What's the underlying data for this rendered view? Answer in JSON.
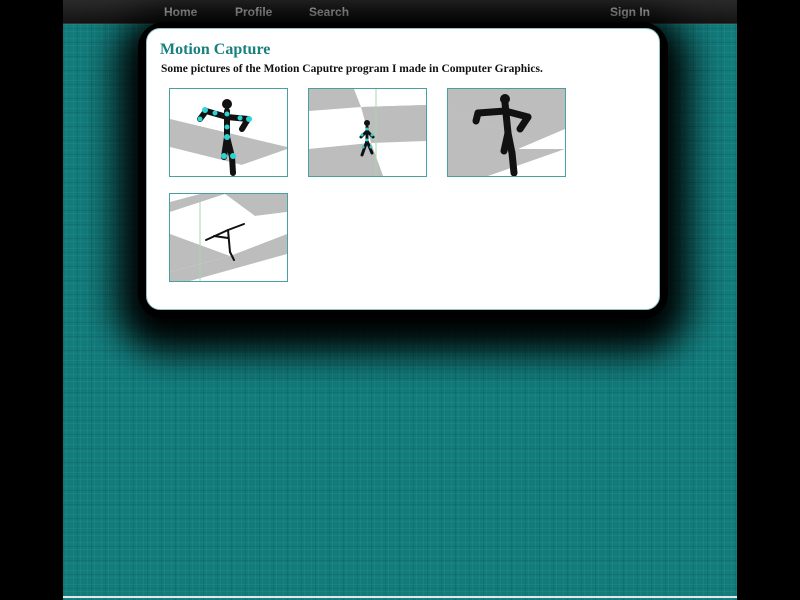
{
  "nav": {
    "home": "Home",
    "profile": "Profile",
    "search": "Search",
    "sign_in": "Sign In"
  },
  "content": {
    "title": "Motion Capture",
    "description": "Some pictures of the Motion Caputre program I made in Computer Graphics."
  },
  "gallery": {
    "thumbnails": [
      {
        "icon": "motion-capture-figure-image"
      },
      {
        "icon": "motion-capture-figure-image"
      },
      {
        "icon": "motion-capture-figure-image"
      },
      {
        "icon": "motion-capture-figure-image"
      }
    ]
  },
  "colors": {
    "background": "#127c7c",
    "accent": "#1a7f7f",
    "joint": "#2ad4d4",
    "floor_gray": "#bdbdbd"
  }
}
